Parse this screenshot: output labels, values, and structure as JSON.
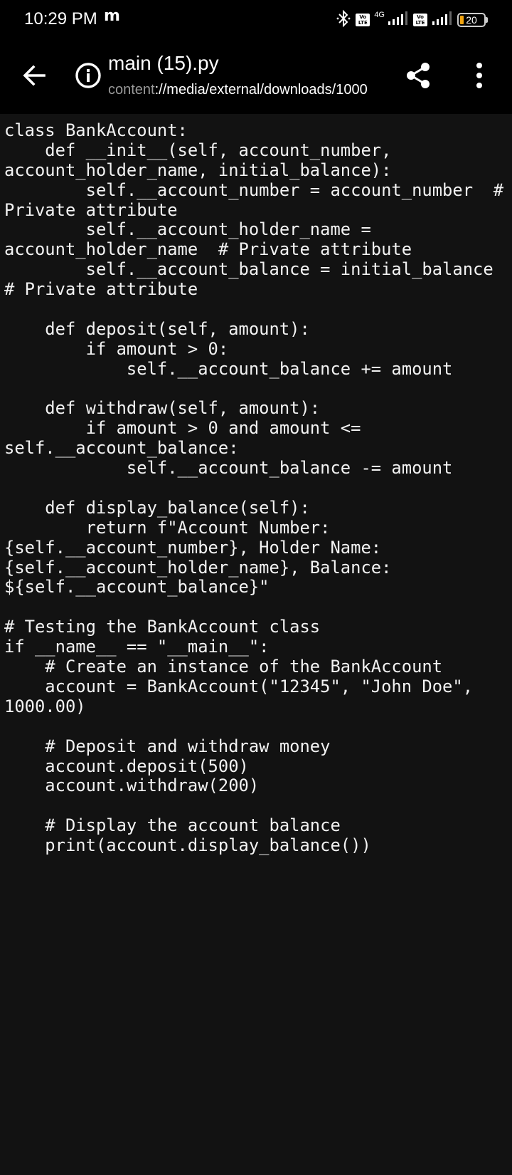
{
  "status_bar": {
    "time": "10:29 PM",
    "carrier_icon": "m",
    "network_type": "4G",
    "volte_label": "Vo LTE",
    "battery_level": "20",
    "icons": [
      "bluetooth-icon",
      "volte-icon",
      "signal-icon",
      "volte-icon",
      "signal-icon",
      "battery-icon"
    ]
  },
  "app_bar": {
    "title": "main (15).py",
    "uri_scheme": "content",
    "uri_rest": "://media/external/downloads/1000",
    "icons": [
      "back-arrow-icon",
      "info-icon",
      "share-icon",
      "more-vert-icon"
    ]
  },
  "code_lines": [
    "class BankAccount:",
    "    def __init__(self, account_number,",
    "account_holder_name, initial_balance):",
    "        self.__account_number = account_number  #",
    "Private attribute",
    "        self.__account_holder_name =",
    "account_holder_name  # Private attribute",
    "        self.__account_balance = initial_balance",
    "# Private attribute",
    "",
    "    def deposit(self, amount):",
    "        if amount > 0:",
    "            self.__account_balance += amount",
    "",
    "    def withdraw(self, amount):",
    "        if amount > 0 and amount <=",
    "self.__account_balance:",
    "            self.__account_balance -= amount",
    "",
    "    def display_balance(self):",
    "        return f\"Account Number:",
    "{self.__account_number}, Holder Name:",
    "{self.__account_holder_name}, Balance:",
    "${self.__account_balance}\"",
    "",
    "# Testing the BankAccount class",
    "if __name__ == \"__main__\":",
    "    # Create an instance of the BankAccount",
    "    account = BankAccount(\"12345\", \"John Doe\",",
    "1000.00)",
    "",
    "    # Deposit and withdraw money",
    "    account.deposit(500)",
    "    account.withdraw(200)",
    "",
    "    # Display the account balance",
    "    print(account.display_balance())"
  ]
}
